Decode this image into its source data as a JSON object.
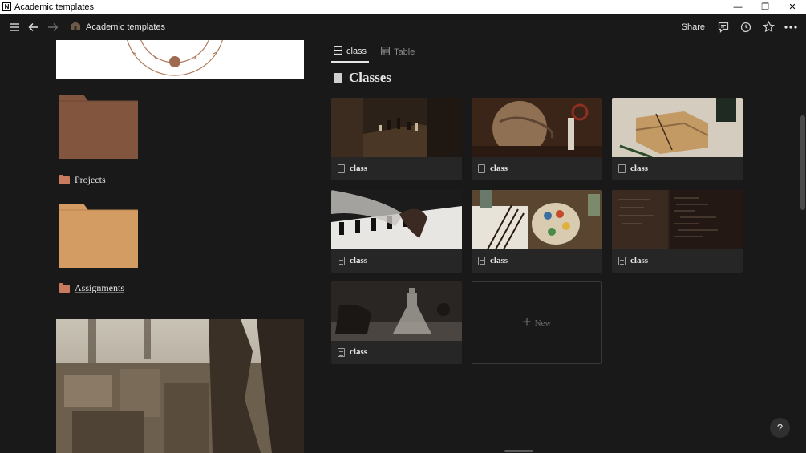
{
  "window": {
    "title": "Academic templates",
    "app_icon": "N",
    "min": "—",
    "max": "❐",
    "close": "✕"
  },
  "topbar": {
    "breadcrumb": "Academic templates",
    "share_label": "Share"
  },
  "left": {
    "folders": [
      {
        "label": "Projects",
        "color": "#82553f"
      },
      {
        "label": "Assignments",
        "color": "#d39c63"
      }
    ]
  },
  "main": {
    "tabs": [
      {
        "label": "class",
        "active": true
      },
      {
        "label": "Table",
        "active": false
      }
    ],
    "section_title": "Classes",
    "cards": [
      {
        "label": "class"
      },
      {
        "label": "class"
      },
      {
        "label": "class"
      },
      {
        "label": "class"
      },
      {
        "label": "class"
      },
      {
        "label": "class"
      },
      {
        "label": "class"
      }
    ],
    "new_label": "New"
  },
  "help_label": "?",
  "colors": {
    "bg": "#191919",
    "card": "#262626",
    "accent_folder": "#c97c5d"
  }
}
